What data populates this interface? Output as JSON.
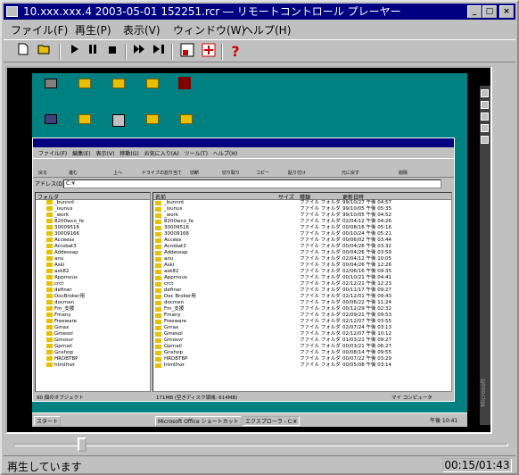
{
  "window": {
    "title": "10.xxx.xxx.4 2003-05-01 152251.rcr ― リモートコントロール プレーヤー"
  },
  "menu": [
    "ファイル(F)",
    "再生(P)",
    "表示(V)",
    "ウィンドウ(W)",
    "ヘルプ(H)"
  ],
  "toolbar": {
    "icons": [
      "new-icon",
      "open-icon",
      "play-icon",
      "pause-icon",
      "stop-icon",
      "fast-forward-icon",
      "step-icon",
      "settings-icon",
      "full-screen-icon",
      "help-icon"
    ],
    "help_glyph": "?"
  },
  "explorer": {
    "menu": [
      "ファイル(F)",
      "編集(E)",
      "表示(V)",
      "移動(G)",
      "お気に入り(A)",
      "ツール(T)",
      "ヘルプ(H)"
    ],
    "tools": [
      "戻る",
      "進む",
      "上へ",
      "ドライブの割り当て",
      "切断",
      "切り取り",
      "コピー",
      "貼り付け",
      "元に戻す",
      "削除"
    ],
    "address_label": "アドレス(D)",
    "address_value": "C:¥",
    "tree_header": "フォルダ",
    "tree": [
      "_bunnnt",
      "_isunus",
      "_work",
      "8200wco_fe",
      "30009516",
      "30009166",
      "Acceess",
      "Acrobat3",
      "Addessap",
      "anu",
      "Aski",
      "ask82",
      "Appmous",
      "crct",
      "definer",
      "DocBroker用",
      "docmen",
      "Fm_支援",
      "Fmany",
      "Freeware",
      "Gmax",
      "Gmesol",
      "Gmosvr",
      "Gprnail",
      "Gnshop",
      "HRDBTBP",
      "htmlfnzr"
    ],
    "columns": [
      "名前",
      "サイズ",
      "種類",
      "更新日時"
    ],
    "files": [
      [
        "_bunnnt",
        "ファイル フォルダ",
        "99/10/27 午後 04:57"
      ],
      [
        "_isunus",
        "ファイル フォルダ",
        "99/10/05 午後 05:35"
      ],
      [
        "_work",
        "ファイル フォルダ",
        "99/10/05 午後 04:52"
      ],
      [
        "8200wco_fe",
        "ファイル フォルダ",
        "02/04/12 午後 04:26"
      ],
      [
        "30009516",
        "ファイル フォルダ",
        "00/08/16 午後 05:16"
      ],
      [
        "30009166",
        "ファイル フォルダ",
        "00/10/24 午後 05:21"
      ],
      [
        "Accees",
        "ファイル フォルダ",
        "00/06/02 午後 03:44"
      ],
      [
        "Acrobat3",
        "ファイル フォルダ",
        "00/04/26 午後 03:32"
      ],
      [
        "Addessap",
        "ファイル フォルダ",
        "00/04/26 午後 03:59"
      ],
      [
        "anu",
        "ファイル フォルダ",
        "02/04/12 午後 10:05"
      ],
      [
        "Aski",
        "ファイル フォルダ",
        "00/04/26 午後 12:26"
      ],
      [
        "ask82",
        "ファイル フォルダ",
        "02/06/16 午後 09:35"
      ],
      [
        "Appmous",
        "ファイル フォルダ",
        "00/10/21 午後 04:41"
      ],
      [
        "crct",
        "ファイル フォルダ",
        "02/12/21 午後 12:23"
      ],
      [
        "definer",
        "ファイル フォルダ",
        "00/11/17 午後 09:27"
      ],
      [
        "Doc Broker用",
        "ファイル フォルダ",
        "02/12/01 午後 09:43"
      ],
      [
        "docmen",
        "ファイル フォルダ",
        "00/06/22 午後 11:24"
      ],
      [
        "Fm_支援",
        "ファイル フォルダ",
        "00/12/29 午後 02:32"
      ],
      [
        "Fmany",
        "ファイル フォルダ",
        "02/09/21 午後 09:53"
      ],
      [
        "Freeware",
        "ファイル フォルダ",
        "02/12/07 午後 03:55"
      ],
      [
        "Gmax",
        "ファイル フォルダ",
        "02/07/24 午後 03:13"
      ],
      [
        "Gmesol",
        "ファイル フォルダ",
        "02/12/07 午後 10:12"
      ],
      [
        "Gmosvr",
        "ファイル フォルダ",
        "01/03/21 午後 09:27"
      ],
      [
        "Gprnail",
        "ファイル フォルダ",
        "00/03/21 午後 06:27"
      ],
      [
        "Gnshop",
        "ファイル フォルダ",
        "00/08/14 午後 09:55"
      ],
      [
        "HRDBTBP",
        "ファイル フォルダ",
        "00/07/22 午後 03:29"
      ],
      [
        "htmlfnzr",
        "ファイル フォルダ",
        "00/05/08 午後 03:14"
      ]
    ],
    "status_left": "90 個のオブジェクト",
    "status_mid": "171MB (空きディスク領域: 614MB)",
    "status_right": "マイ コンピュータ"
  },
  "taskbar": {
    "start": "スタート",
    "task1": "Microsoft Office ショートカット",
    "task2": "エクスプローラ - C:¥",
    "clock": "午後 10:41"
  },
  "sidebar_brand": "Microsoft",
  "player": {
    "status": "再生しています",
    "time": "00:15/01:43",
    "progress": 0.14
  }
}
